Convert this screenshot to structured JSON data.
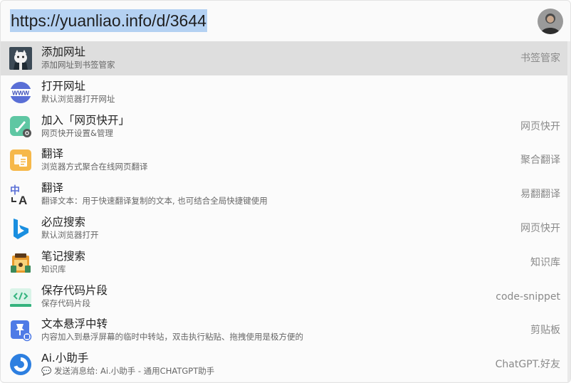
{
  "search": {
    "query": "https://yuanliao.info/d/3644"
  },
  "results": [
    {
      "title": "添加网址",
      "subtitle": "添加网址到书签管家",
      "plugin": "书签管家",
      "icon": "cat-avatar-icon"
    },
    {
      "title": "打开网址",
      "subtitle": "默认浏览器打开网址",
      "plugin": "",
      "icon": "www-globe-icon"
    },
    {
      "title": "加入「网页快开」",
      "subtitle": "网页快开设置&管理",
      "plugin": "网页快开",
      "icon": "rocket-icon"
    },
    {
      "title": "翻译",
      "subtitle": "浏览器方式聚合在线网页翻译",
      "plugin": "聚合翻译",
      "icon": "translate-doc-icon"
    },
    {
      "title": "翻译",
      "subtitle": "翻译文本：用于快速翻译复制的文本, 也可结合全局快捷键使用",
      "plugin": "易翻翻译",
      "icon": "zh-a-translate-icon"
    },
    {
      "title": "必应搜索",
      "subtitle": "默认浏览器打开",
      "plugin": "网页快开",
      "icon": "bing-icon"
    },
    {
      "title": "笔记搜索",
      "subtitle": "知识库",
      "plugin": "知识库",
      "icon": "notebook-icon"
    },
    {
      "title": "保存代码片段",
      "subtitle": "保存代码片段",
      "plugin": "code-snippet",
      "icon": "code-icon"
    },
    {
      "title": "文本悬浮中转",
      "subtitle": "内容加入到悬浮屏幕的临时中转站，双击执行粘贴、拖拽使用是极方便的",
      "plugin": "剪贴板",
      "icon": "pin-icon"
    },
    {
      "title": "Ai.小助手",
      "subtitle": "💬 发送消息给: Ai.小助手 - 通用CHATGPT助手",
      "plugin": "ChatGPT.好友",
      "icon": "ai-assistant-icon"
    }
  ],
  "colors": {
    "selected_row": "#dedede",
    "query_highlight": "#b4d1f2"
  }
}
